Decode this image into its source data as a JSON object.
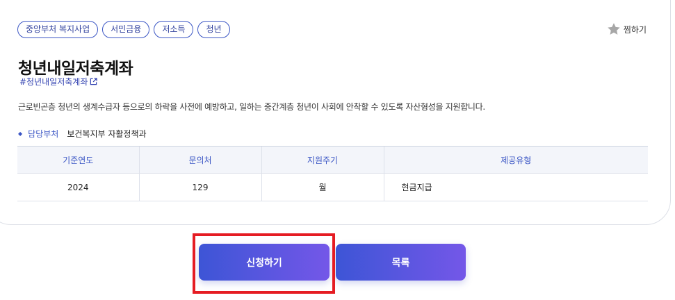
{
  "tags": [
    "중앙부처 복지사업",
    "서민금융",
    "저소득",
    "청년"
  ],
  "favorite_label": "찜하기",
  "title": "청년내일저축계좌",
  "hashtag": "#청년내일저축계좌",
  "description": "근로빈곤층 청년의 생계수급자 등으로의 하락을 사전에 예방하고, 일하는 중간계층 청년이 사회에 안착할 수 있도록 자산형성을 지원합니다.",
  "department": {
    "label": "담당부처",
    "value": "보건복지부 자활정책과"
  },
  "table": {
    "headers": [
      "기준연도",
      "문의처",
      "지원주기",
      "제공유형"
    ],
    "row": [
      "2024",
      "129",
      "월",
      "현금지급"
    ]
  },
  "buttons": {
    "apply": "신청하기",
    "list": "목록"
  },
  "colors": {
    "accent": "#3a55c4",
    "button_start": "#3d55d6",
    "button_end": "#7457e8",
    "highlight": "#e51c23"
  }
}
